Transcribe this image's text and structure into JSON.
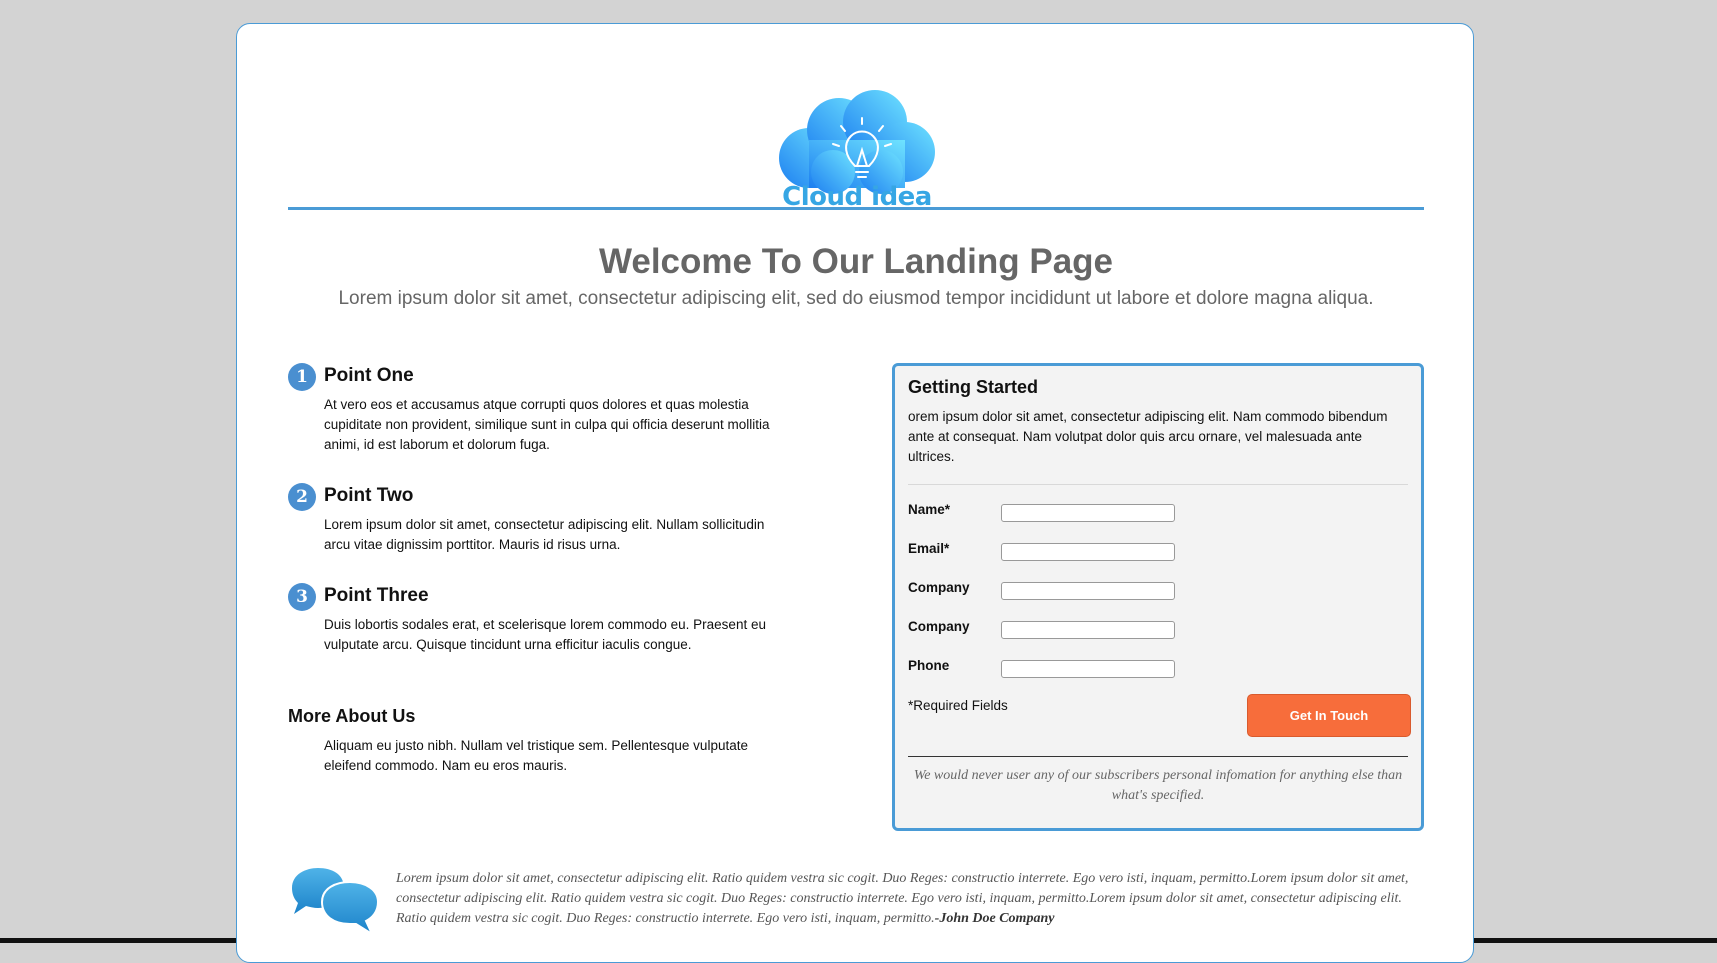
{
  "logo": {
    "text": "Cloud idea",
    "colors": {
      "light": "#6fe3ff",
      "dark": "#1d7ff0",
      "text": "#36a6e4"
    }
  },
  "hero": {
    "title": "Welcome To Our Landing Page",
    "subtitle": "Lorem ipsum dolor sit amet, consectetur adipiscing elit, sed do eiusmod tempor incididunt ut labore et dolore magna aliqua."
  },
  "points": [
    {
      "number": "1",
      "title": "Point One",
      "body": "At vero eos et accusamus atque corrupti quos dolores et quas molestia cupiditate non provident, similique sunt in culpa qui officia deserunt mollitia animi, id est laborum et dolorum fuga."
    },
    {
      "number": "2",
      "title": "Point Two",
      "body": "Lorem ipsum dolor sit amet, consectetur adipiscing elit. Nullam sollicitudin arcu vitae dignissim porttitor. Mauris id risus urna."
    },
    {
      "number": "3",
      "title": "Point Three",
      "body": "Duis lobortis sodales erat, et scelerisque lorem commodo eu. Praesent eu vulputate arcu. Quisque tincidunt urna efficitur iaculis congue."
    }
  ],
  "more": {
    "title": "More About Us",
    "body": "Aliquam eu justo nibh. Nullam vel tristique sem. Pellentesque vulputate eleifend commodo. Nam eu eros mauris."
  },
  "form": {
    "title": "Getting Started",
    "intro": "orem ipsum dolor sit amet, consectetur adipiscing elit. Nam commodo bibendum ante at consequat. Nam volutpat dolor quis arcu ornare, vel malesuada ante ultrices.",
    "fields": [
      {
        "label": "Name*",
        "value": "",
        "placeholder": ""
      },
      {
        "label": "Email*",
        "value": "",
        "placeholder": ""
      },
      {
        "label": "Company",
        "value": "",
        "placeholder": ""
      },
      {
        "label": "Company",
        "value": "",
        "placeholder": ""
      },
      {
        "label": "Phone",
        "value": "",
        "placeholder": ""
      }
    ],
    "required_note": "*Required Fields",
    "submit_label": "Get In Touch",
    "privacy": "We would never user any of our subscribers personal infomation for anything else than what's specified."
  },
  "testimonial": {
    "text": "Lorem ipsum dolor sit amet, consectetur adipiscing elit. Ratio quidem vestra sic cogit. Duo Reges: constructio interrete. Ego vero isti, inquam, permitto.Lorem ipsum dolor sit amet, consectetur adipiscing elit. Ratio quidem vestra sic cogit. Duo Reges: constructio interrete. Ego vero isti, inquam, permitto.Lorem ipsum dolor sit amet, consectetur adipiscing elit. Ratio quidem vestra sic cogit. Duo Reges: constructio interrete. Ego vero isti, inquam, permitto.",
    "author": "-John Doe Company",
    "icon": "speech-bubbles-icon"
  },
  "colors": {
    "accent": "#4a9bd6",
    "button": "#f76d3b",
    "background": "#d3d3d3"
  }
}
